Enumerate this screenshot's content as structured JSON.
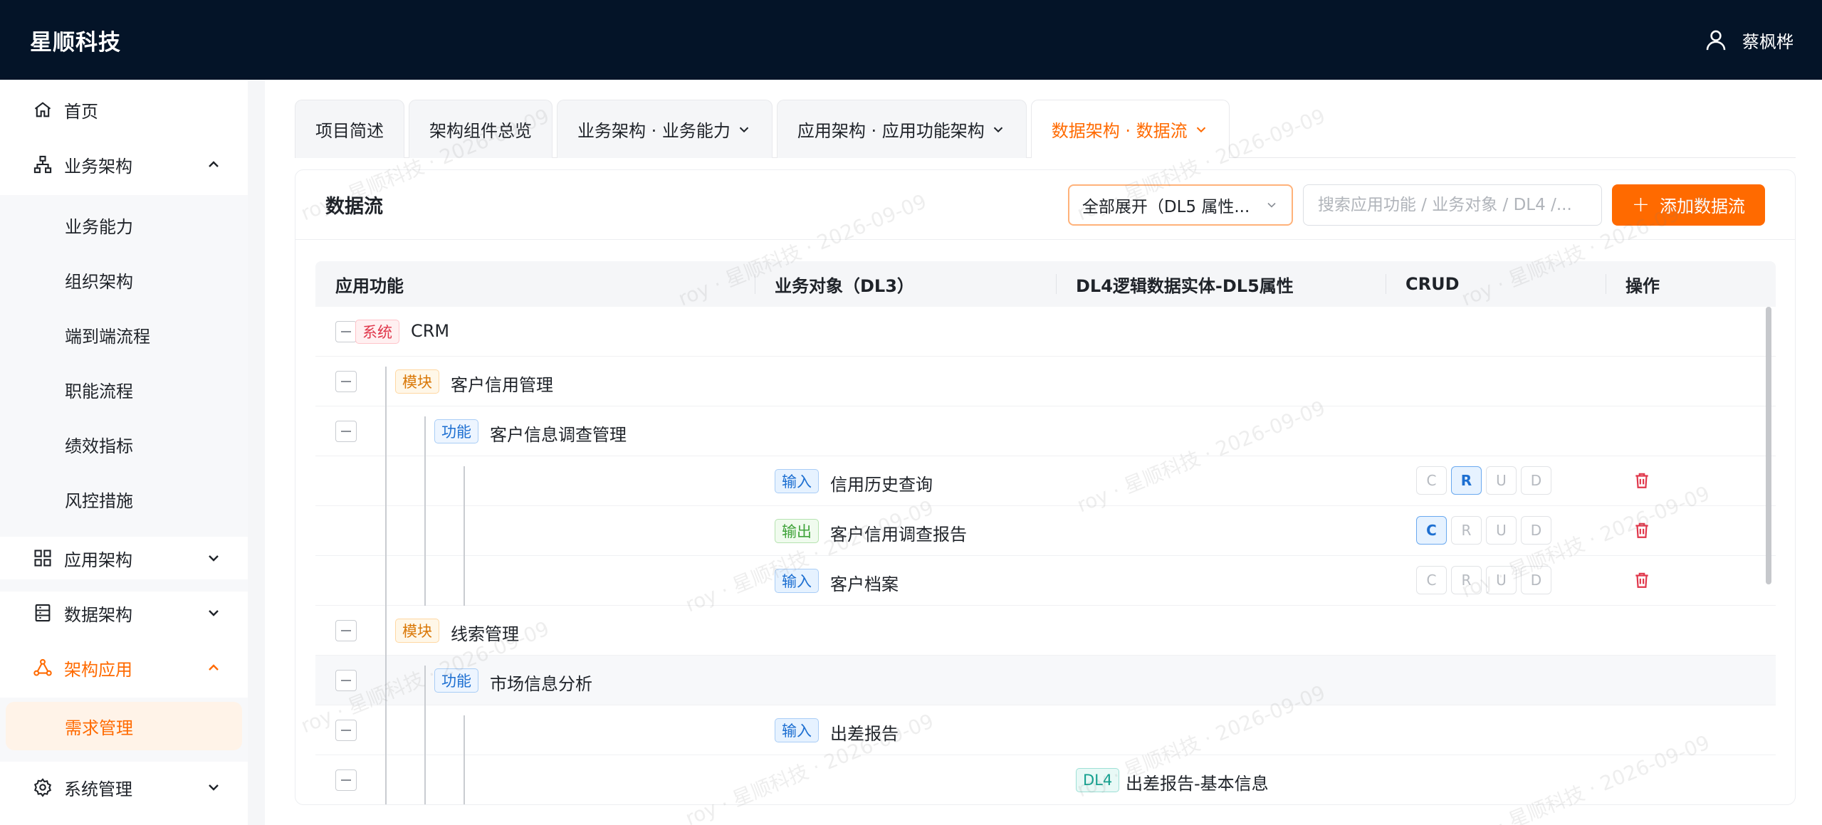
{
  "header": {
    "brand": "星顺科技",
    "user_name": "蔡枫桦"
  },
  "sidebar": {
    "items": [
      {
        "label": "首页",
        "icon": "home-icon"
      },
      {
        "label": "业务架构",
        "icon": "org-icon"
      },
      {
        "label": "应用架构",
        "icon": "grid-icon"
      },
      {
        "label": "数据架构",
        "icon": "database-icon"
      },
      {
        "label": "架构应用",
        "icon": "share-icon"
      },
      {
        "label": "系统管理",
        "icon": "gear-icon"
      }
    ],
    "biz_sub": [
      "业务能力",
      "组织架构",
      "端到端流程",
      "职能流程",
      "绩效指标",
      "风控措施"
    ],
    "app_sub": [
      "需求管理"
    ]
  },
  "tabs": [
    {
      "label": "项目简述"
    },
    {
      "label": "架构组件总览"
    },
    {
      "label": "业务架构 · 业务能力"
    },
    {
      "label": "应用架构 · 应用功能架构"
    },
    {
      "label": "数据架构 · 数据流"
    }
  ],
  "card": {
    "title": "数据流",
    "select_value": "全部展开（DL5 属性...",
    "search_placeholder": "搜索应用功能 / 业务对象 / DL4 /...",
    "add_button": "添加数据流"
  },
  "table": {
    "headers": [
      "应用功能",
      "业务对象（DL3）",
      "DL4逻辑数据实体-DL5属性",
      "CRUD",
      "操作"
    ],
    "crud_letters": [
      "C",
      "R",
      "U",
      "D"
    ],
    "tag_labels": {
      "system": "系统",
      "module": "模块",
      "function": "功能",
      "input": "输入",
      "output": "输出",
      "dl4": "DL4"
    },
    "rows": [
      {
        "level": 0,
        "tag": "system",
        "text": "CRM"
      },
      {
        "level": 1,
        "tag": "module",
        "text": "客户信用管理"
      },
      {
        "level": 2,
        "tag": "function",
        "text": "客户信息调查管理"
      },
      {
        "level": 3,
        "tag": "input",
        "text": "信用历史查询",
        "crud_on": [
          "R"
        ]
      },
      {
        "level": 3,
        "tag": "output",
        "text": "客户信用调查报告",
        "crud_on": [
          "C"
        ]
      },
      {
        "level": 3,
        "tag": "input",
        "text": "客户档案",
        "crud_on": []
      },
      {
        "level": 1,
        "tag": "module",
        "text": "线索管理"
      },
      {
        "level": 2,
        "tag": "function",
        "text": "市场信息分析"
      },
      {
        "level": 3,
        "tag": "input",
        "text": "出差报告"
      },
      {
        "level": 4,
        "tag": "dl4",
        "text": "出差报告-基本信息"
      }
    ]
  },
  "watermark_text": "roy · 星顺科技 · 2026-09-09",
  "colors": {
    "accent": "#ff6a00",
    "header_bg": "#041428"
  }
}
